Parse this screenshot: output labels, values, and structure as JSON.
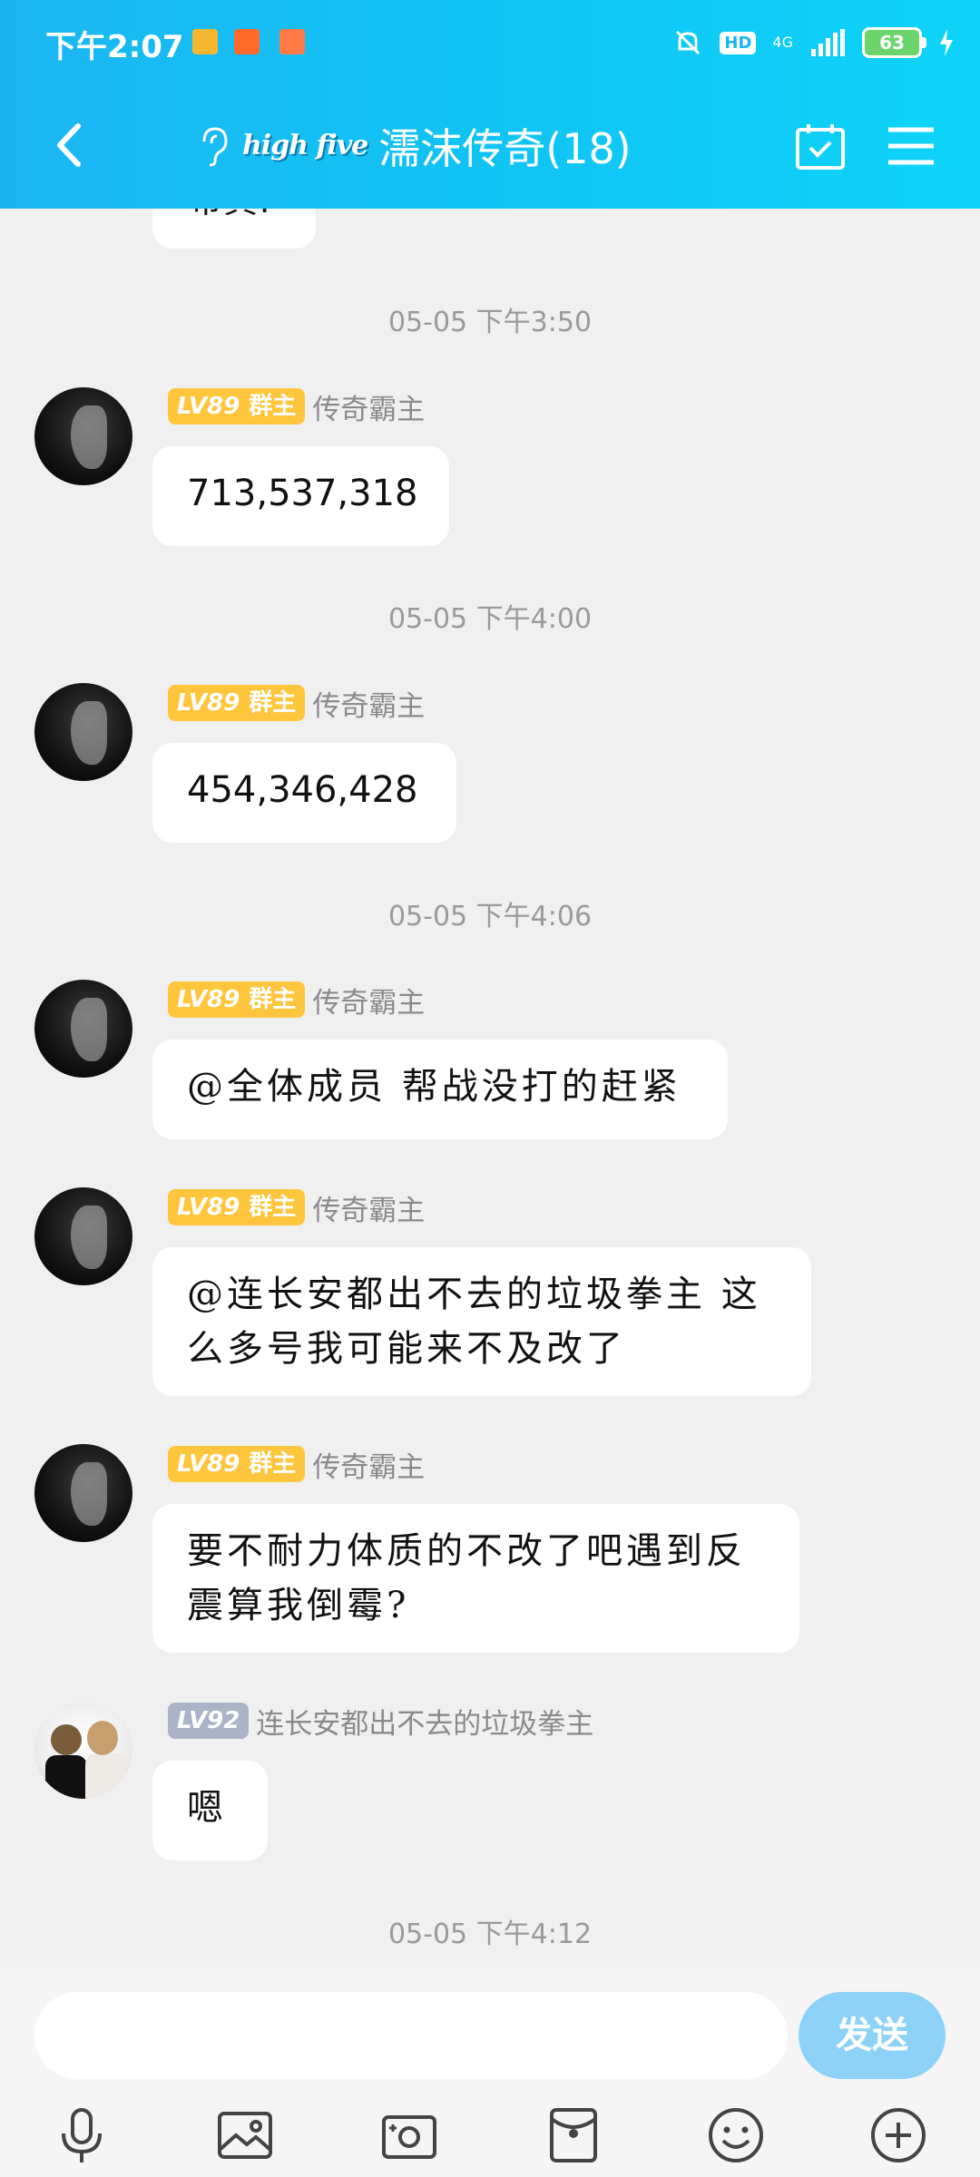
{
  "status_bar": {
    "time": "下午2:07",
    "hd": "HD",
    "network": "4G",
    "battery": "63"
  },
  "header": {
    "logo": "high five",
    "title": "濡沫传奇(18)"
  },
  "chat": {
    "partial_top_text": "带真!",
    "timestamps": [
      "05-05 下午3:50",
      "05-05 下午4:00",
      "05-05 下午4:06",
      "05-05 下午4:12"
    ],
    "messages": [
      {
        "level": "LV89",
        "role": "群主",
        "sender": "传奇霸主",
        "text": "713,537,318"
      },
      {
        "level": "LV89",
        "role": "群主",
        "sender": "传奇霸主",
        "text": "454,346,428"
      },
      {
        "level": "LV89",
        "role": "群主",
        "sender": "传奇霸主",
        "text": "@全体成员  帮战没打的赶紧"
      },
      {
        "level": "LV89",
        "role": "群主",
        "sender": "传奇霸主",
        "text": "@连长安都出不去的垃圾拳主 这么多号我可能来不及改了"
      },
      {
        "level": "LV89",
        "role": "群主",
        "sender": "传奇霸主",
        "text": "要不耐力体质的不改了吧遇到反震算我倒霉?"
      },
      {
        "level": "LV92",
        "role": "",
        "sender": "连长安都出不去的垃圾拳主",
        "text": "嗯"
      }
    ]
  },
  "input": {
    "placeholder": "",
    "send_label": "发送"
  },
  "colors": {
    "header_start": "#1bb6f2",
    "header_end": "#0ed4f8",
    "badge_owner": "#ffc53d",
    "badge_member": "#aab3c7",
    "send": "#8dd2f6"
  }
}
